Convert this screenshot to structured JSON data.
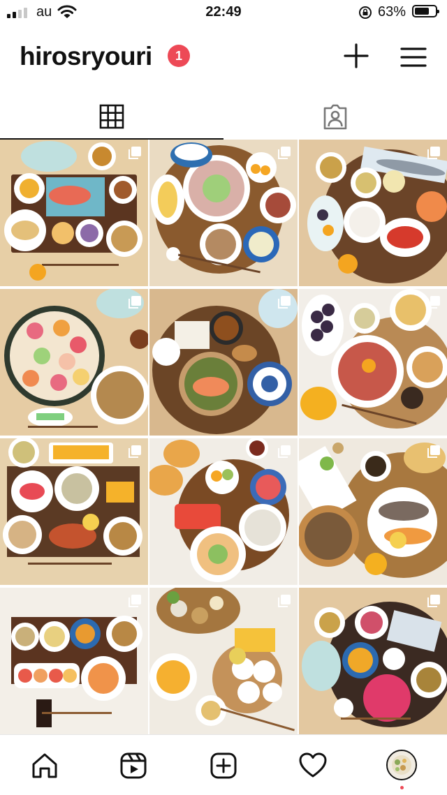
{
  "status_bar": {
    "carrier": "au",
    "time": "22:49",
    "battery": "63%",
    "battery_level": 0.63
  },
  "header": {
    "username": "hirosryouri",
    "notification_count": "1"
  },
  "icons": {
    "add": "plus-icon",
    "menu": "hamburger-menu-icon",
    "grid_tab": "grid-icon",
    "tagged_tab": "tagged-person-icon"
  },
  "tabs": {
    "active": "grid"
  },
  "posts": [
    {
      "id": "post-1",
      "multiple": true,
      "bg": "#e7cfa6",
      "accent": "#d9a95f"
    },
    {
      "id": "post-2",
      "multiple": true,
      "bg": "#eadbc2",
      "accent": "#8a5a2e"
    },
    {
      "id": "post-3",
      "multiple": true,
      "bg": "#e2c7a0",
      "accent": "#6b4428"
    },
    {
      "id": "post-4",
      "multiple": true,
      "bg": "#e6cca4",
      "accent": "#3d4b3a"
    },
    {
      "id": "post-5",
      "multiple": true,
      "bg": "#d8b88e",
      "accent": "#6b4526"
    },
    {
      "id": "post-6",
      "multiple": true,
      "bg": "#f2eee8",
      "accent": "#b98a55"
    },
    {
      "id": "post-7",
      "multiple": true,
      "bg": "#e7d2ad",
      "accent": "#5b3a24"
    },
    {
      "id": "post-8",
      "multiple": true,
      "bg": "#f1ede6",
      "accent": "#7a4a24"
    },
    {
      "id": "post-9",
      "multiple": true,
      "bg": "#efe9df",
      "accent": "#a8783f"
    },
    {
      "id": "post-10",
      "multiple": true,
      "bg": "#f3efe8",
      "accent": "#5b3420"
    },
    {
      "id": "post-11",
      "multiple": true,
      "bg": "#f0ebe2",
      "accent": "#a4763f"
    },
    {
      "id": "post-12",
      "multiple": true,
      "bg": "#e3c8a0",
      "accent": "#3b2a22"
    }
  ],
  "bottom_nav": {
    "items": [
      "home-icon",
      "reels-icon",
      "new-post-icon",
      "activity-heart-icon",
      "profile-avatar"
    ]
  },
  "colors": {
    "badge": "#ed4956",
    "text": "#111111"
  }
}
